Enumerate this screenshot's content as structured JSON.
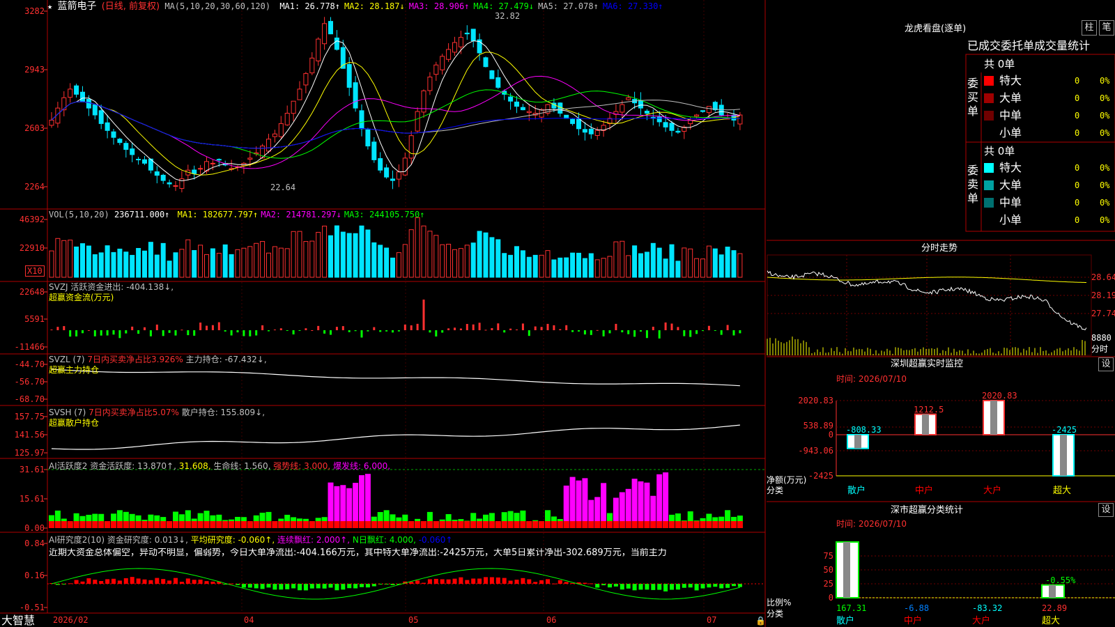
{
  "stock": {
    "name": "蓝箭电子",
    "mode": "(日线, 前复权)",
    "star": "★",
    "ma_title": "MA(5,10,20,30,60,120)",
    "ma": [
      {
        "label": "MA1:",
        "value": "26.778",
        "arrow": "↑",
        "color": "#ffffff"
      },
      {
        "label": "MA2:",
        "value": "28.187",
        "arrow": "↓",
        "color": "#ffff00"
      },
      {
        "label": "MA3:",
        "value": "28.906",
        "arrow": "↑",
        "color": "#ff00ff"
      },
      {
        "label": "MA4:",
        "value": "27.479",
        "arrow": "↓",
        "color": "#00ff00"
      },
      {
        "label": "MA5:",
        "value": "27.078",
        "arrow": "↑",
        "color": "#c0c0c0"
      },
      {
        "label": "MA6:",
        "value": "27.330",
        "arrow": "↑",
        "color": "#0000ff"
      }
    ],
    "price_ticks": [
      "3282",
      "2943",
      "2603",
      "2264"
    ],
    "high_label": "32.82",
    "low_label": "22.64"
  },
  "vol": {
    "title": "VOL(5,10,20)",
    "value": "236711.000↑",
    "ma": [
      {
        "label": "MA1:",
        "value": "182677.797↑",
        "color": "#ffff00"
      },
      {
        "label": "MA2:",
        "value": "214781.297↓",
        "color": "#ff00ff"
      },
      {
        "label": "MA3:",
        "value": "244105.750↑",
        "color": "#00ff00"
      }
    ],
    "ticks": [
      "46392",
      "22910"
    ],
    "unit": "X10"
  },
  "svzj": {
    "line1": "SVZJ  活跃资金进出: -404.138↓,",
    "line2": "超赢资金流(万元)",
    "ticks": [
      "22648",
      "5591",
      "-11466"
    ]
  },
  "svzl": {
    "prefix": "SVZL (7)",
    "mid": "7日内买卖净占比3.926%",
    "suffix": "主力持仓: -67.432↓,",
    "line2": "超赢主力持仓",
    "ticks": [
      "-44.70",
      "-56.70",
      "-68.70"
    ]
  },
  "svsh": {
    "prefix": "SVSH (7)",
    "mid": "7日内买卖净占比5.07%",
    "suffix": "散户持仓: 155.809↓,",
    "line2": "超赢散户持仓",
    "ticks": [
      "157.75",
      "141.56",
      "125.97"
    ]
  },
  "ai1": {
    "parts": [
      {
        "text": "AI活跃度2 资金活跃度: 13.870↑,",
        "color": "#c0c0c0"
      },
      {
        "text": " 31.608,",
        "color": "#ffff00"
      },
      {
        "text": " 生命线: 1.560,",
        "color": "#c0c0c0"
      },
      {
        "text": " 强势线: 3.000,",
        "color": "#ff3030"
      },
      {
        "text": " 爆发线: 6.000,",
        "color": "#ff00ff"
      }
    ],
    "ticks": [
      "31.61",
      "15.61",
      "0.00"
    ]
  },
  "ai2": {
    "parts": [
      {
        "text": "AI研究度2(10) 资金研究度: 0.013↓,",
        "color": "#c0c0c0"
      },
      {
        "text": " 平均研究度: -0.060↑,",
        "color": "#ffff00"
      },
      {
        "text": " 连续飘红: 2.000↑,",
        "color": "#ff00ff"
      },
      {
        "text": " N日飘红: 4.000,",
        "color": "#00ff00"
      },
      {
        "text": " -0.060↑",
        "color": "#0000ff"
      }
    ],
    "summary": "近期大资金总体偏空，异动不明显，偏弱势，今日大单净流出:-404.166万元，其中特大单净流出:-2425万元，大单5日累计净出-302.689万元，当前主力",
    "ticks": [
      "0.84",
      "0.16",
      "-0.51"
    ]
  },
  "xaxis": {
    "brand": "大智慧",
    "labels": [
      "2026/02",
      "04",
      "05",
      "06",
      "07"
    ]
  },
  "right": {
    "dragon_title": "龙虎看盘(逐单)",
    "btn_zhu": "柱",
    "btn_bi": "笔",
    "header": "已成交委托单成交量统计",
    "buy_total": "共 0单",
    "buy_label": "委买单",
    "sell_total": "共 0单",
    "sell_label": "委卖单",
    "buy_rows": [
      {
        "name": "特大",
        "count": "0",
        "pct": "0%",
        "color": "#ff0000"
      },
      {
        "name": "大单",
        "count": "0",
        "pct": "0%",
        "color": "#a00000"
      },
      {
        "name": "中单",
        "count": "0",
        "pct": "0%",
        "color": "#700000"
      },
      {
        "name": "小单",
        "count": "0",
        "pct": "0%",
        "color": ""
      }
    ],
    "sell_rows": [
      {
        "name": "特大",
        "count": "0",
        "pct": "0%",
        "color": "#00ffff"
      },
      {
        "name": "大单",
        "count": "0",
        "pct": "0%",
        "color": "#00a0a0"
      },
      {
        "name": "中单",
        "count": "0",
        "pct": "0%",
        "color": "#007070"
      },
      {
        "name": "小单",
        "count": "0",
        "pct": "0%",
        "color": ""
      }
    ],
    "intraday_title": "分时走势",
    "intraday_ticks": [
      "28.64",
      "28.19",
      "27.74"
    ],
    "intraday_vol": "8880",
    "intraday_vol_label": "分时",
    "monitor_title": "深圳超赢实时监控",
    "monitor_time": "时间: 2026/07/10",
    "set_label": "设",
    "monitor_ticks": [
      "2020.83",
      "538.89",
      "0",
      "-943.06",
      "-2425"
    ],
    "monitor_unit": "净额(万元)",
    "monitor_cat_label": "分类",
    "stats_title": "深市超赢分类统计",
    "stats_time": "时间: 2026/07/10",
    "stats_ticks": [
      "75",
      "50",
      "25",
      "0"
    ],
    "stats_unit": "比例%",
    "stats_cat_label": "分类",
    "categories": [
      "散户",
      "中户",
      "大户",
      "超大"
    ],
    "cat_colors": [
      "#00ffff",
      "#ff0000",
      "#ff0000",
      "#ffff00"
    ]
  },
  "chart_data": [
    {
      "type": "bar",
      "title": "深圳超赢实时监控",
      "categories": [
        "散户",
        "中户",
        "大户",
        "超大"
      ],
      "values": [
        -808.33,
        1212.5,
        2020.83,
        -2425
      ],
      "ylim": [
        -2425,
        2020.83
      ],
      "ylabel": "净额(万元)"
    },
    {
      "type": "bar",
      "title": "深市超赢分类统计",
      "categories": [
        "散户",
        "中户",
        "大户",
        "超大"
      ],
      "values": [
        167.31,
        -6.88,
        -83.32,
        22.89
      ],
      "labels_shown": [
        "167.31",
        "-6.88",
        "-83.32",
        "22.89",
        "-0.55%"
      ],
      "ylim": [
        0,
        100
      ],
      "ylabel": "比例%"
    }
  ]
}
